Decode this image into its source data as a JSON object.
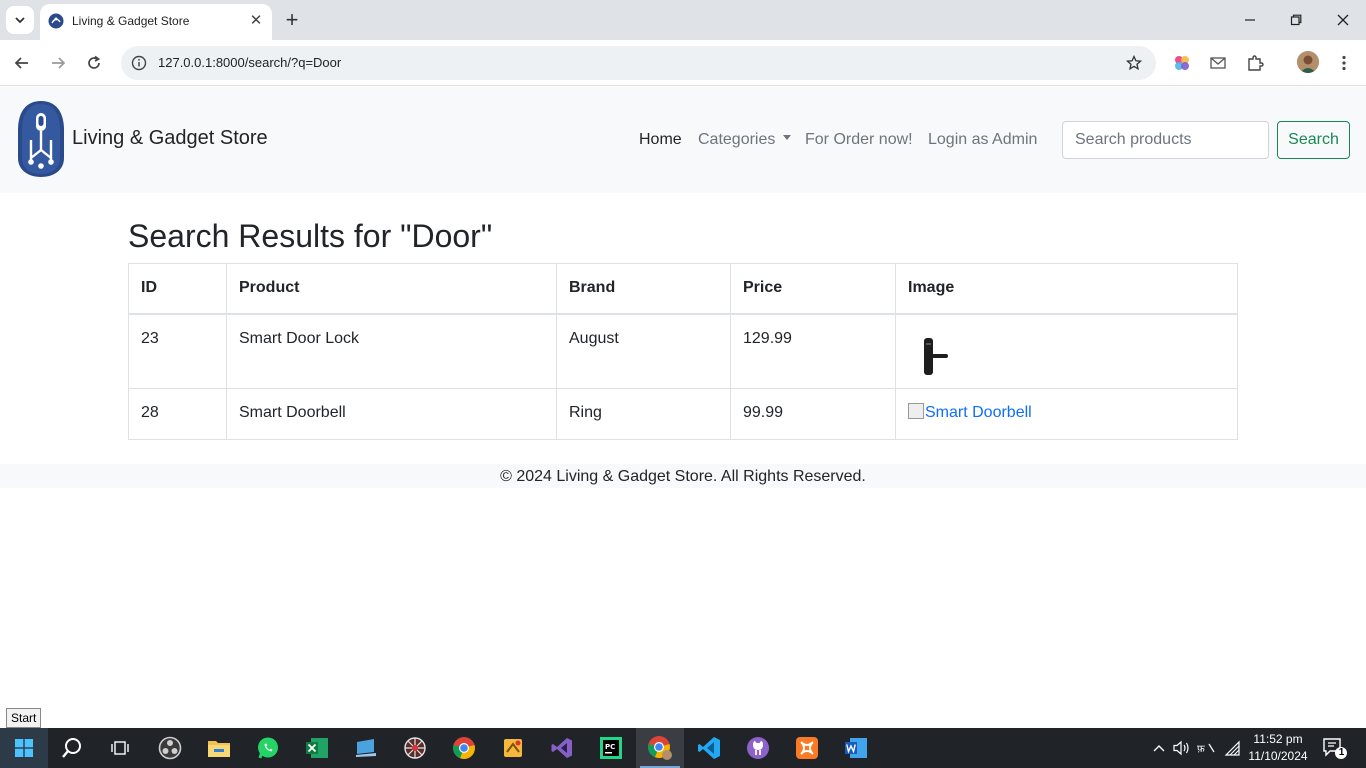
{
  "browser": {
    "tab_title": "Living & Gadget Store",
    "url": "127.0.0.1:8000/search/?q=Door"
  },
  "navbar": {
    "brand": "Living & Gadget Store",
    "links": {
      "home": "Home",
      "categories": "Categories",
      "order": "For Order now!",
      "login": "Login as Admin"
    },
    "search_placeholder": "Search products",
    "search_button": "Search"
  },
  "main": {
    "title": "Search Results for \"Door\"",
    "table": {
      "headers": [
        "ID",
        "Product",
        "Brand",
        "Price",
        "Image"
      ],
      "rows": [
        {
          "id": "23",
          "product": "Smart Door Lock",
          "brand": "August",
          "price": "129.99",
          "image_alt": ""
        },
        {
          "id": "28",
          "product": "Smart Doorbell",
          "brand": "Ring",
          "price": "99.99",
          "image_alt": "Smart Doorbell"
        }
      ]
    }
  },
  "footer": {
    "text": "© 2024 Living & Gadget Store. All Rights Reserved."
  },
  "os": {
    "tooltip": "Start",
    "clock_time": "11:52 pm",
    "clock_date": "11/10/2024",
    "notification_count": "1"
  },
  "colors": {
    "navbar_bg": "#f8f9fa",
    "search_button": "#198754",
    "link": "#0d6efd",
    "taskbar": "#202428"
  }
}
